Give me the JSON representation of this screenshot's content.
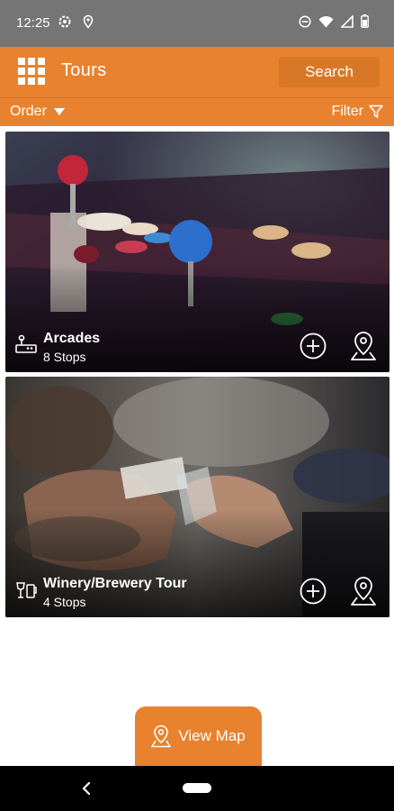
{
  "status_bar": {
    "time": "12:25",
    "icons": [
      "settings-icon",
      "location-icon",
      "do-not-disturb-icon",
      "wifi-icon",
      "signal-icon",
      "battery-icon"
    ]
  },
  "app_bar": {
    "title": "Tours",
    "search_label": "Search",
    "menu_icon": "apps-grid-icon"
  },
  "toolbar": {
    "order_label": "Order",
    "filter_label": "Filter"
  },
  "tours": [
    {
      "name": "Arcades",
      "stops": "8 Stops",
      "icon": "arcade-icon"
    },
    {
      "name": "Winery/Brewery Tour",
      "stops": "4 Stops",
      "icon": "drinks-icon"
    }
  ],
  "view_map": {
    "label": "View Map"
  },
  "colors": {
    "accent": "#e8822f",
    "status_bar": "#757575",
    "nav_bar": "#000000"
  }
}
